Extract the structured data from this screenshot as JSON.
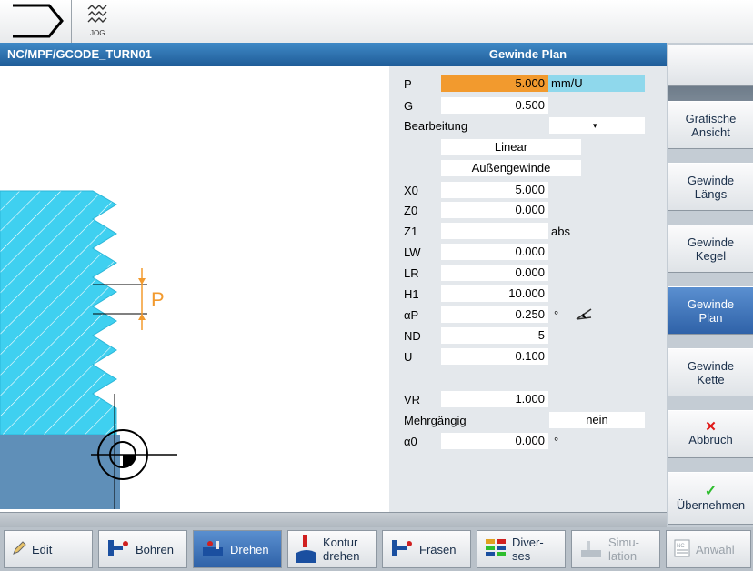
{
  "top": {
    "mode_label": "JOG"
  },
  "header": {
    "path": "NC/MPF/GCODE_TURN01",
    "title": "Gewinde Plan"
  },
  "graphic": {
    "label_p": "P"
  },
  "form": {
    "rows": [
      {
        "label": "P",
        "value": "5.000",
        "unit": "mm/U"
      },
      {
        "label": "G",
        "value": "0.500"
      },
      {
        "label": "Bearbeitung",
        "value": ""
      },
      {
        "label": "",
        "value": "Linear"
      },
      {
        "label": "",
        "value": "Außengewinde"
      },
      {
        "label": "X0",
        "value": "5.000"
      },
      {
        "label": "Z0",
        "value": "0.000"
      },
      {
        "label": "Z1",
        "value": "",
        "unit": "abs"
      },
      {
        "label": "LW",
        "value": "0.000"
      },
      {
        "label": "LR",
        "value": "0.000"
      },
      {
        "label": "H1",
        "value": "10.000"
      },
      {
        "label": "αP",
        "value": "0.250",
        "unit": "°"
      },
      {
        "label": "ND",
        "value": "5"
      },
      {
        "label": "U",
        "value": "0.100"
      },
      {
        "label": "VR",
        "value": "1.000"
      },
      {
        "label": "Mehrgängig",
        "value": "nein"
      },
      {
        "label": "α0",
        "value": "0.000",
        "unit": "°"
      }
    ]
  },
  "right_softkeys": [
    {
      "label": "Grafische Ansicht"
    },
    {
      "label": "Gewinde Längs"
    },
    {
      "label": "Gewinde Kegel"
    },
    {
      "label": "Gewinde Plan"
    },
    {
      "label": "Gewinde Kette"
    },
    {
      "label": "Abbruch"
    },
    {
      "label": "Übernehmen"
    }
  ],
  "bottom_softkeys": [
    {
      "label": "Edit"
    },
    {
      "label": "Bohren"
    },
    {
      "label": "Drehen"
    },
    {
      "label": "Kontur drehen"
    },
    {
      "label": "Fräsen"
    },
    {
      "label": "Diver- ses"
    },
    {
      "label": "Simu- lation"
    },
    {
      "label": "Anwahl"
    }
  ],
  "colors": {
    "accent_orange": "#f29a2e",
    "cyan_thread": "#3fd0f0",
    "active_blue": "#2f62a8"
  }
}
